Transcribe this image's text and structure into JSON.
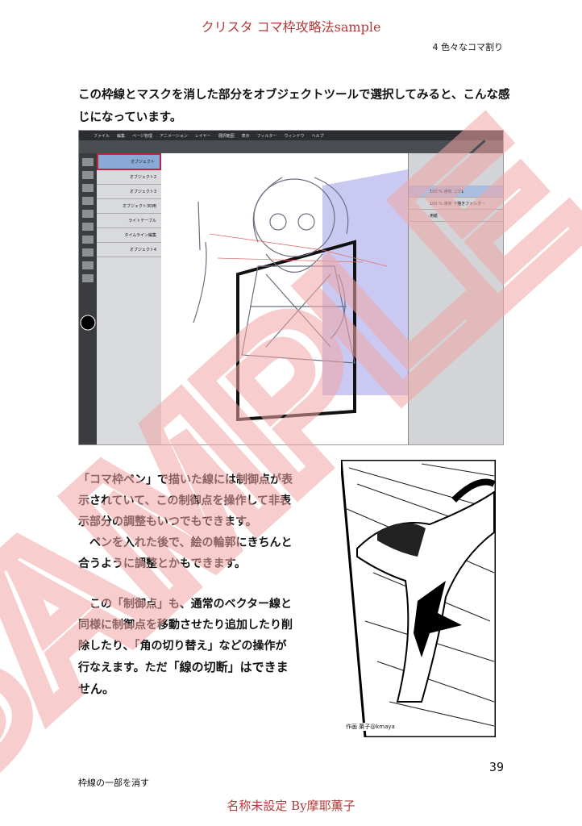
{
  "header": {
    "title": "クリスタ コマ枠攻略法sample",
    "chapter": "4 色々なコマ割り"
  },
  "intro": "この枠線とマスクを消した部分をオブジェクトツールで選択してみると、こんな感じになっています。",
  "screenshot": {
    "menu": [
      "ファイル",
      "編集",
      "ページ管理",
      "アニメーション",
      "レイヤー",
      "選択範囲",
      "表示",
      "フィルター",
      "ウィンドウ",
      "ヘルプ"
    ],
    "subtool_items": [
      "オブジェクト",
      "オブジェクト2",
      "オブジェクト3",
      "オブジェクト3D用",
      "ライトテーブル",
      "タイムライン編集",
      "オブジェクト4"
    ],
    "layers": [
      "100 % 通常 コマ1",
      "100 % 通常 下描きフォルダー",
      "用紙"
    ]
  },
  "body": [
    "「コマ枠ペン」で描いた線には制御点が表示されていて、この制御点を操作して非表示部分の調整もいつでもできます。",
    "ペンを入れた後で、絵の輪郭にきちんと合うように調整とかもできます。",
    "この「制御点」も、通常のベクター線と同様に制御点を移動させたり追加したり削除したり、「角の切り替え」などの操作が行なえます。ただ"
  ],
  "body_emphasis": "「線の切断」はできません。",
  "manga_credit": "作画 菓子@kmaya",
  "page_number": "39",
  "section_label": "枠線の一部を消す",
  "footer": "名称未設定 By摩耶薫子",
  "watermark": "SAMPLE"
}
